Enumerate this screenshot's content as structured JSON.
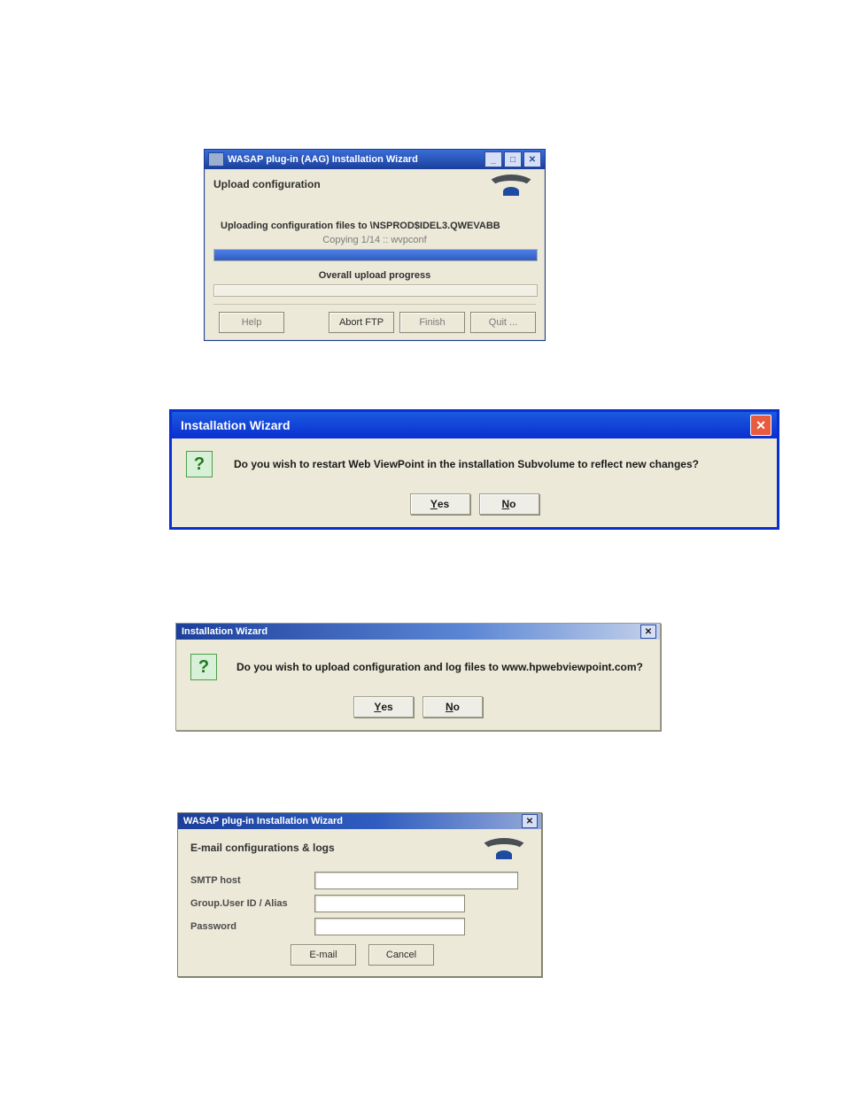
{
  "fig1": {
    "title": "WASAP plug-in (AAG) Installation Wizard",
    "subtitle": "Upload configuration",
    "uploading_msg": "Uploading configuration files to \\NSPROD$IDEL3.QWEVABB",
    "copying": "Copying 1/14 :: wvpconf",
    "overall_label": "Overall upload progress",
    "buttons": {
      "help": "Help",
      "abort": "Abort FTP",
      "finish": "Finish",
      "quit": "Quit ..."
    },
    "win_controls": {
      "min": "_",
      "max": "□",
      "close": "✕"
    }
  },
  "fig2": {
    "title": "Installation Wizard",
    "message": "Do you wish to restart Web ViewPoint in the installation Subvolume to reflect new changes?",
    "yes_u": "Y",
    "yes_rest": "es",
    "no_u": "N",
    "no_rest": "o",
    "close_glyph": "✕"
  },
  "fig3": {
    "title": "Installation Wizard",
    "message": "Do you wish to upload configuration and log files to www.hpwebviewpoint.com?",
    "yes_u": "Y",
    "yes_rest": "es",
    "no_u": "N",
    "no_rest": "o",
    "close_glyph": "✕"
  },
  "fig4": {
    "title": "WASAP plug-in Installation Wizard",
    "section": "E-mail configurations & logs",
    "fields": {
      "smtp_label": "SMTP host",
      "user_label": "Group.User ID / Alias",
      "pass_label": "Password",
      "smtp_value": "",
      "user_value": "",
      "pass_value": ""
    },
    "buttons": {
      "email": "E-mail",
      "cancel": "Cancel"
    },
    "close_glyph": "✕"
  },
  "question_glyph": "?"
}
